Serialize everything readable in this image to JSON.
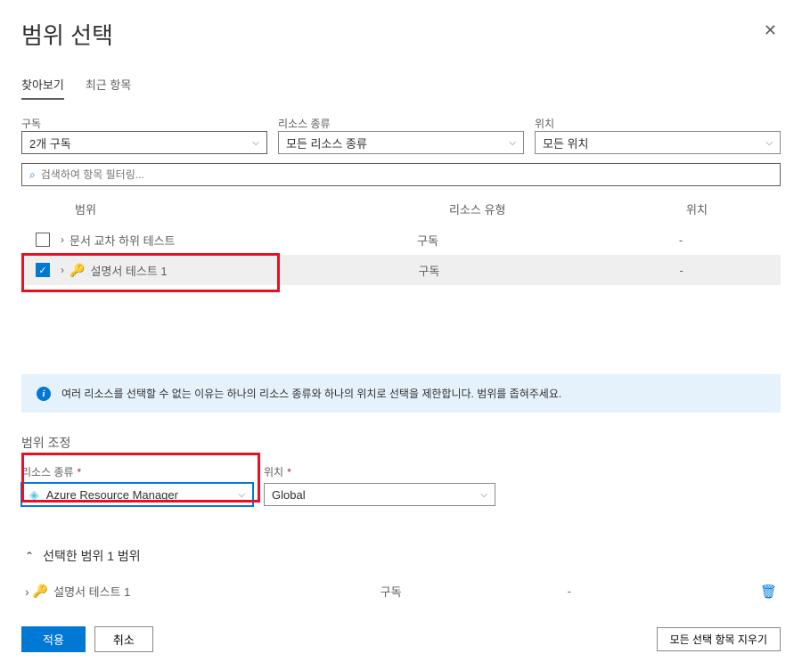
{
  "header": {
    "title": "범위 선택",
    "close_icon": "✕"
  },
  "tabs": {
    "browse": "찾아보기",
    "recent": "최근 항목"
  },
  "filters": {
    "subscription": {
      "label": "구독",
      "value": "2개 구독"
    },
    "resource_type": {
      "label": "리소스 종류",
      "value": "모든 리소스 종류"
    },
    "location": {
      "label": "위치",
      "value": "모든 위치"
    }
  },
  "search": {
    "placeholder": "검색하여 항목 필터링..."
  },
  "table": {
    "headers": {
      "scope": "범위",
      "type": "리소스 유형",
      "location": "위치"
    },
    "rows": [
      {
        "checked": false,
        "name": "문서 교차 하위 테스트",
        "type": "구독",
        "location": "-"
      },
      {
        "checked": true,
        "name": "설명서 테스트 1",
        "type": "구독",
        "location": "-"
      }
    ]
  },
  "info": {
    "message": "여러 리소스를 선택할 수 없는 이유는 하나의 리소스 종류와 하나의 위치로 선택을 제한합니다. 범위를 좁혀주세요."
  },
  "narrow": {
    "title": "범위 조정",
    "resource_type": {
      "label": "리소스 종류",
      "value": "Azure Resource Manager"
    },
    "location": {
      "label": "위치",
      "value": "Global"
    }
  },
  "selected": {
    "title": "선택한 범위 1 범위",
    "row": {
      "name": "설명서 테스트 1",
      "type": "구독",
      "location": "-"
    }
  },
  "footer": {
    "apply": "적용",
    "cancel": "취소",
    "clear_all": "모든 선택 항목 지우기"
  }
}
